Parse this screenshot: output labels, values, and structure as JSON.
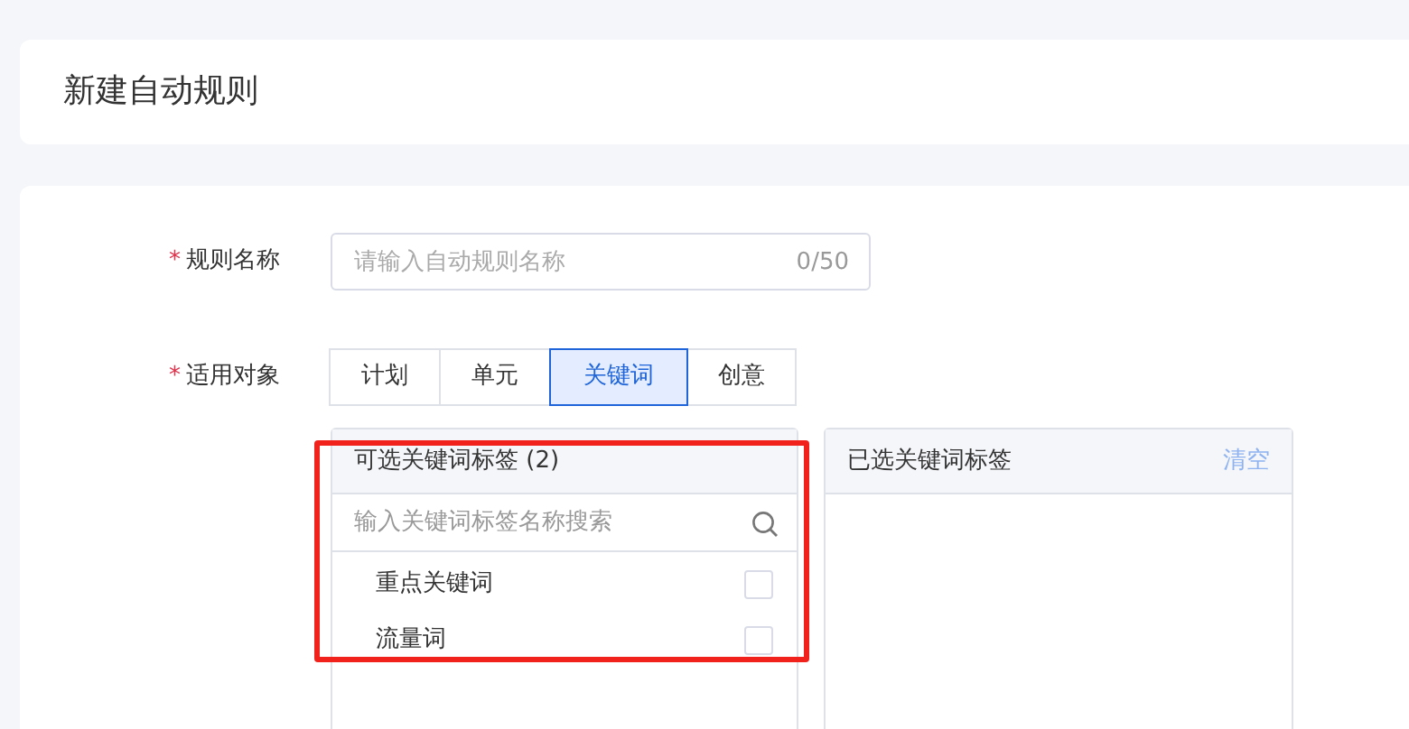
{
  "page_title": "新建自动规则",
  "form": {
    "name_field": {
      "required_mark": "*",
      "label": "规则名称",
      "placeholder": "请输入自动规则名称",
      "counter": "0/50"
    },
    "target": {
      "required_mark": "*",
      "label": "适用对象",
      "options": [
        {
          "label": "计划",
          "selected": false
        },
        {
          "label": "单元",
          "selected": false
        },
        {
          "label": "关键词",
          "selected": true
        },
        {
          "label": "创意",
          "selected": false
        }
      ]
    }
  },
  "available_panel": {
    "title": "可选关键词标签",
    "count": "(2)",
    "highlighted": true,
    "search_placeholder": "输入关键词标签名称搜索",
    "items": [
      {
        "label": "重点关键词",
        "checked": false
      },
      {
        "label": "流量词",
        "checked": false
      }
    ]
  },
  "selected_panel": {
    "title": "已选关键词标签",
    "clear": "清空"
  }
}
